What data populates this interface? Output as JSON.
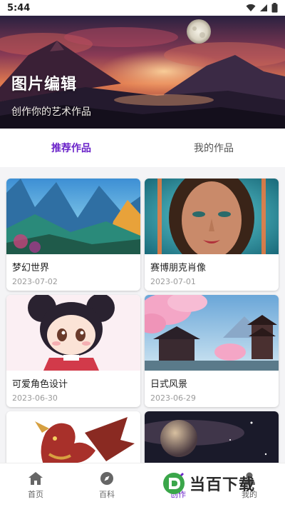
{
  "status_bar": {
    "time": "5:44"
  },
  "hero": {
    "title": "图片编辑",
    "subtitle": "创作你的艺术作品"
  },
  "tabs": [
    {
      "label": "推荐作品",
      "active": true
    },
    {
      "label": "我的作品",
      "active": false
    }
  ],
  "works": [
    {
      "title": "梦幻世界",
      "date": "2023-07-02"
    },
    {
      "title": "赛博朋克肖像",
      "date": "2023-07-01"
    },
    {
      "title": "可爱角色设计",
      "date": "2023-06-30"
    },
    {
      "title": "日式风景",
      "date": "2023-06-29"
    },
    {
      "title": "",
      "date": ""
    },
    {
      "title": "",
      "date": ""
    }
  ],
  "bottom_nav": [
    {
      "label": "首页",
      "icon": "home-icon",
      "active": false
    },
    {
      "label": "百科",
      "icon": "compass-icon",
      "active": false
    },
    {
      "label": "创作",
      "icon": "brush-icon",
      "active": true
    },
    {
      "label": "我的",
      "icon": "user-icon",
      "active": false
    }
  ],
  "watermark": {
    "text": "当百下载"
  },
  "colors": {
    "accent": "#6a22c9",
    "background": "#f4f4f6",
    "inactive_text": "#666666",
    "date_text": "#9a9a9a"
  }
}
